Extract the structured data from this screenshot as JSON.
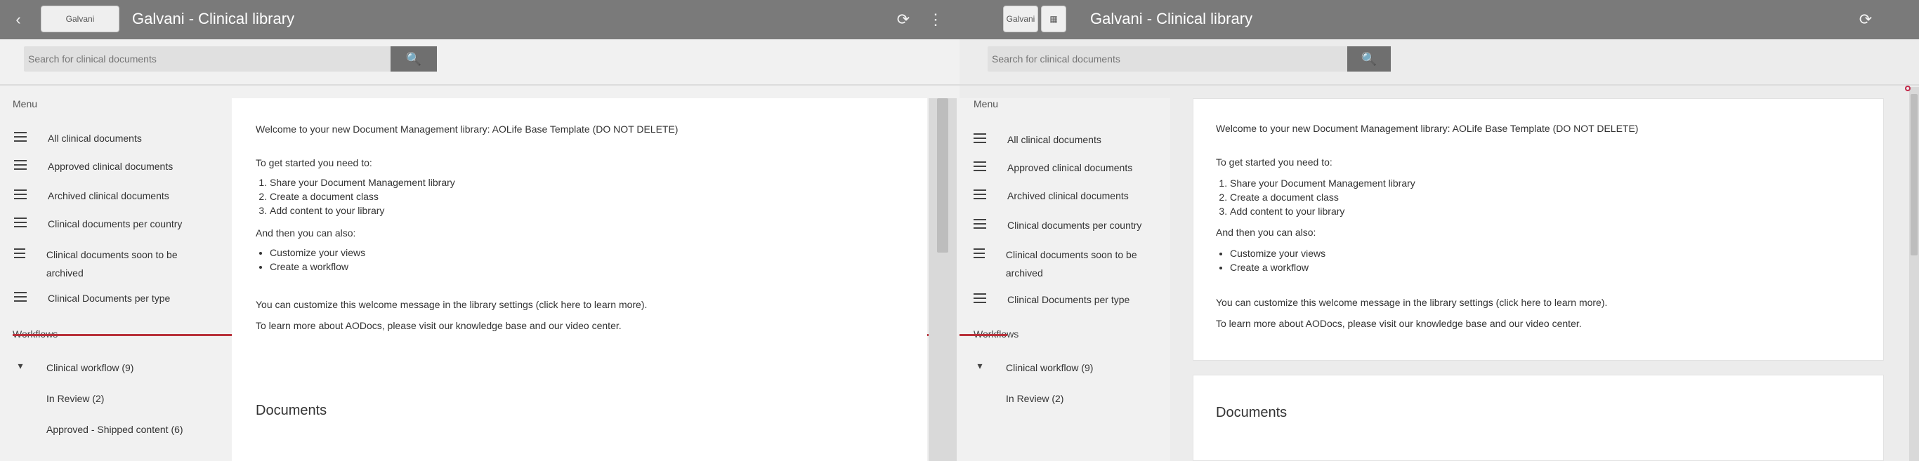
{
  "app": {
    "title": "Galvani - Clinical library",
    "logo_text": "Galvani"
  },
  "search": {
    "placeholder": "Search for clinical documents",
    "button_icon": "search-icon"
  },
  "sidebar": {
    "menu_label": "Menu",
    "items": [
      {
        "label": "All clinical documents"
      },
      {
        "label": "Approved clinical documents"
      },
      {
        "label": "Archived clinical documents"
      },
      {
        "label": "Clinical documents per country"
      },
      {
        "label": "Clinical documents soon to be archived"
      },
      {
        "label": "Clinical Documents per type"
      }
    ],
    "workflows_label": "Workflows",
    "workflows": [
      {
        "label": "Clinical workflow (9)"
      },
      {
        "label": "In Review (2)"
      },
      {
        "label": "Approved - Shipped content (6)"
      }
    ]
  },
  "welcome": {
    "heading": "Welcome to your new Document Management library: AOLife Base Template (DO NOT DELETE)",
    "get_started": "To get started you need to:",
    "steps": [
      "Share your Document Management library",
      "Create a document class",
      "Add content to your library"
    ],
    "then_label": "And then you can also:",
    "extras": [
      "Customize your views",
      "Create a workflow"
    ],
    "customize_note": "You can customize this welcome message in the library settings (click here to learn more).",
    "learn_more": "To learn more about AODocs, please visit our knowledge base and our video center."
  },
  "documents_section": {
    "title": "Documents"
  },
  "colors": {
    "topbar": "#7a7a7a",
    "search_button": "#6f6f6f",
    "accent_red": "#b8313a"
  }
}
